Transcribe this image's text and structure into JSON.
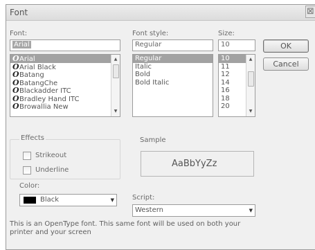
{
  "window": {
    "title": "Font",
    "close_glyph": "⊠"
  },
  "font": {
    "label": "Font:",
    "value": "Arial",
    "items": [
      {
        "name": "Arial",
        "selected": true
      },
      {
        "name": "Arial Black"
      },
      {
        "name": "Batang"
      },
      {
        "name": "BatangChe"
      },
      {
        "name": "Blackadder ITC"
      },
      {
        "name": "Bradley Hand ITC"
      },
      {
        "name": "Browallia New"
      }
    ]
  },
  "font_style": {
    "label": "Font style:",
    "value": "Regular",
    "items": [
      {
        "name": "Regular",
        "selected": true
      },
      {
        "name": "Italic"
      },
      {
        "name": "Bold"
      },
      {
        "name": "Bold Italic"
      }
    ]
  },
  "size": {
    "label": "Size:",
    "value": "10",
    "items": [
      {
        "name": "10",
        "selected": true
      },
      {
        "name": "11"
      },
      {
        "name": "12"
      },
      {
        "name": "14"
      },
      {
        "name": "16"
      },
      {
        "name": "18"
      },
      {
        "name": "20"
      }
    ]
  },
  "buttons": {
    "ok": "OK",
    "cancel": "Cancel"
  },
  "effects": {
    "title": "Effects",
    "strikeout": "Strikeout",
    "underline": "Underline",
    "color_label": "Color:",
    "color_value": "Black",
    "color_swatch": "#000000"
  },
  "sample": {
    "title": "Sample",
    "text": "AaBbYyZz"
  },
  "script": {
    "label": "Script:",
    "value": "Western"
  },
  "info_text": "This is an OpenType font. This same font will be used on both your printer and your screen"
}
